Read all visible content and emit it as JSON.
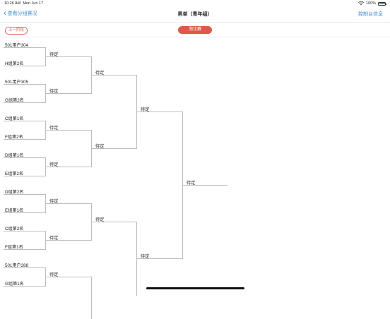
{
  "status_bar": {
    "time": "10:26 AM",
    "date": "Mon Jun 17",
    "battery": "100%"
  },
  "nav": {
    "back_label": "查看分组赛况",
    "title": "男单（青年组）",
    "action_label": "控制台信息"
  },
  "stage": {
    "prev_label": "上一阶段",
    "current_label": "淘汰赛"
  },
  "bracket": {
    "round1": [
      {
        "top": "501用户304",
        "bottom": "H组第2名",
        "result": "待定"
      },
      {
        "top": "501用户305",
        "bottom": "G组第2名",
        "result": "待定"
      },
      {
        "top": "C组第1名",
        "bottom": "F组第2名",
        "result": "待定"
      },
      {
        "top": "D组第1名",
        "bottom": "E组第2名",
        "result": "待定"
      },
      {
        "top": "D组第2名",
        "bottom": "E组第1名",
        "result": "待定"
      },
      {
        "top": "C组第2名",
        "bottom": "F组第1名",
        "result": "待定"
      },
      {
        "top": "501用户288",
        "bottom": "G组第1名",
        "result": "待定"
      }
    ],
    "round2": [
      "待定",
      "待定",
      "待定"
    ],
    "round3": [
      "待定",
      "待定"
    ],
    "round4": [
      "待定"
    ]
  }
}
